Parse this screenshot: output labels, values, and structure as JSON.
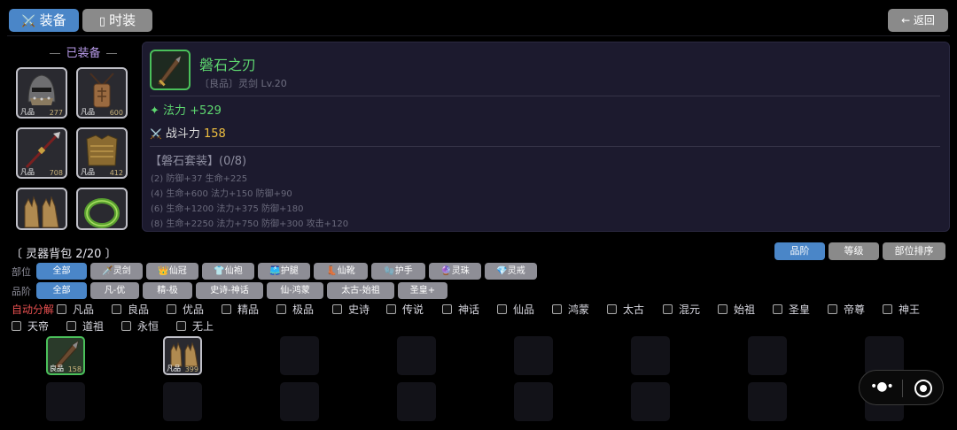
{
  "tabs": {
    "equip": "装备",
    "fashion": "时装",
    "equip_icon": "⚔️",
    "fashion_icon": "▯"
  },
  "back_label": "← 返回",
  "equipped": {
    "title": "已装备",
    "slots": [
      {
        "icon": "helmet-icon",
        "quality": "凡品",
        "level": "277"
      },
      {
        "icon": "amulet-icon",
        "quality": "凡品",
        "level": "600"
      },
      {
        "icon": "spear-icon",
        "quality": "凡品",
        "level": "708"
      },
      {
        "icon": "armor-icon",
        "quality": "凡品",
        "level": "412"
      },
      {
        "icon": "gloves-icon",
        "quality": "",
        "level": ""
      },
      {
        "icon": "ring-icon",
        "quality": "",
        "level": ""
      }
    ]
  },
  "detail": {
    "name": "磐石之刃",
    "sub": "〔良品〕灵剑  Lv.20",
    "stat_magic": "✦ 法力 +529",
    "power_label": "战斗力",
    "power_value": "158",
    "power_icon": "⚔️",
    "set_title": "【磐石套装】(0/8)",
    "set_bonuses": [
      "(2) 防御+37 生命+225",
      "(4) 生命+600 法力+150 防御+90",
      "(6) 生命+1200 法力+375 防御+180",
      "(8) 生命+2250 法力+750 防御+300 攻击+120"
    ]
  },
  "bag": {
    "title": "〔 灵器背包  2/20 〕",
    "sort_buttons": [
      "品阶",
      "等级",
      "部位排序"
    ],
    "part_label": "部位",
    "parts": [
      "全部",
      "🗡️灵剑",
      "👑仙冠",
      "👕仙袍",
      "🩳护腿",
      "👢仙靴",
      "🧤护手",
      "🔮灵珠",
      "💎灵戒"
    ],
    "rank_label": "品阶",
    "ranks": [
      "全部",
      "凡-优",
      "精-极",
      "史诗-神话",
      "仙-鸿蒙",
      "太古-始祖",
      "圣皇+"
    ],
    "auto_label": "自动分解",
    "auto_options": [
      "凡品",
      "良品",
      "优品",
      "精品",
      "极品",
      "史诗",
      "传说",
      "神话",
      "仙品",
      "鸿蒙",
      "太古",
      "混元",
      "始祖",
      "圣皇",
      "帝尊",
      "神王",
      "天帝",
      "道祖",
      "永恒",
      "无上"
    ],
    "items": [
      {
        "icon": "sword-icon",
        "quality": "良品",
        "level": "158",
        "border": "#4ac05a",
        "bg": "#2a3a2a"
      },
      {
        "icon": "gloves-icon",
        "quality": "凡品",
        "level": "399",
        "border": "#c0c0c8",
        "bg": "#2a2a30"
      }
    ]
  }
}
